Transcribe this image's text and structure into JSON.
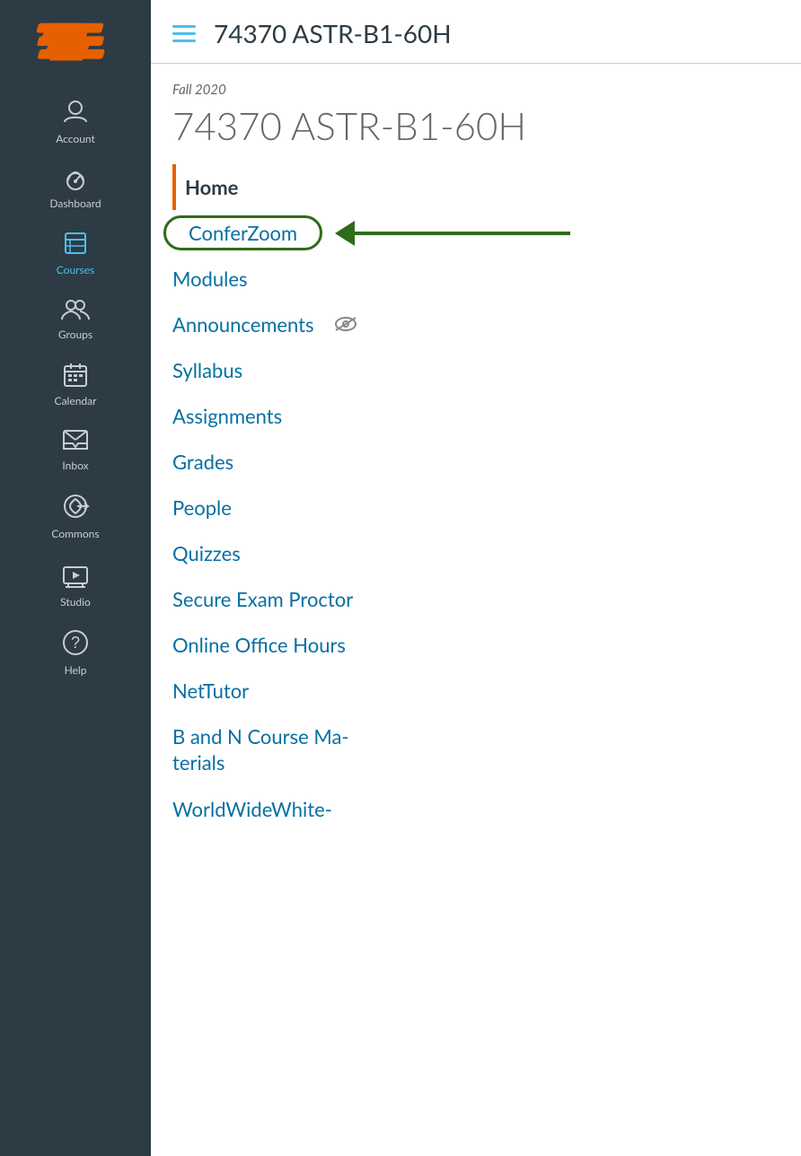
{
  "sidebar": {
    "logo_alt": "Canvas LMS Logo",
    "nav_items": [
      {
        "id": "account",
        "label": "Account",
        "icon": "account"
      },
      {
        "id": "dashboard",
        "label": "Dashboard",
        "icon": "dashboard"
      },
      {
        "id": "courses",
        "label": "Courses",
        "icon": "courses",
        "active": true
      },
      {
        "id": "groups",
        "label": "Groups",
        "icon": "groups"
      },
      {
        "id": "calendar",
        "label": "Calendar",
        "icon": "calendar"
      },
      {
        "id": "inbox",
        "label": "Inbox",
        "icon": "inbox"
      },
      {
        "id": "commons",
        "label": "Commons",
        "icon": "commons"
      },
      {
        "id": "studio",
        "label": "Studio",
        "icon": "studio"
      },
      {
        "id": "help",
        "label": "Help",
        "icon": "help"
      }
    ]
  },
  "header": {
    "course_id": "74370 ASTR-B1-60H",
    "hamburger_label": "Toggle navigation"
  },
  "course": {
    "semester": "Fall 2020",
    "title": "74370 ASTR-B1-60H"
  },
  "nav": {
    "items": [
      {
        "id": "home",
        "label": "Home",
        "type": "home"
      },
      {
        "id": "conferzoom",
        "label": "ConferZoom",
        "type": "conferzoom",
        "highlighted": true
      },
      {
        "id": "modules",
        "label": "Modules",
        "type": "link"
      },
      {
        "id": "announcements",
        "label": "Announcements",
        "type": "link",
        "has_eye": true
      },
      {
        "id": "syllabus",
        "label": "Syllabus",
        "type": "link"
      },
      {
        "id": "assignments",
        "label": "Assignments",
        "type": "link"
      },
      {
        "id": "grades",
        "label": "Grades",
        "type": "link"
      },
      {
        "id": "people",
        "label": "People",
        "type": "link"
      },
      {
        "id": "quizzes",
        "label": "Quizzes",
        "type": "link"
      },
      {
        "id": "secure-exam",
        "label": "Secure Exam Proctor",
        "type": "link"
      },
      {
        "id": "online-office",
        "label": "Online Office Hours",
        "type": "link"
      },
      {
        "id": "nettutor",
        "label": "NetTutor",
        "type": "link"
      },
      {
        "id": "bn-course",
        "label": "B and N Course Ma-\nterials",
        "type": "link"
      },
      {
        "id": "worldwide",
        "label": "WorldWideWhite-",
        "type": "link"
      }
    ]
  },
  "colors": {
    "sidebar_bg": "#2d3b45",
    "brand_orange": "#e66000",
    "link_blue": "#0770a3",
    "arrow_green": "#2e6b1a",
    "active_blue": "#4dc0e8"
  }
}
